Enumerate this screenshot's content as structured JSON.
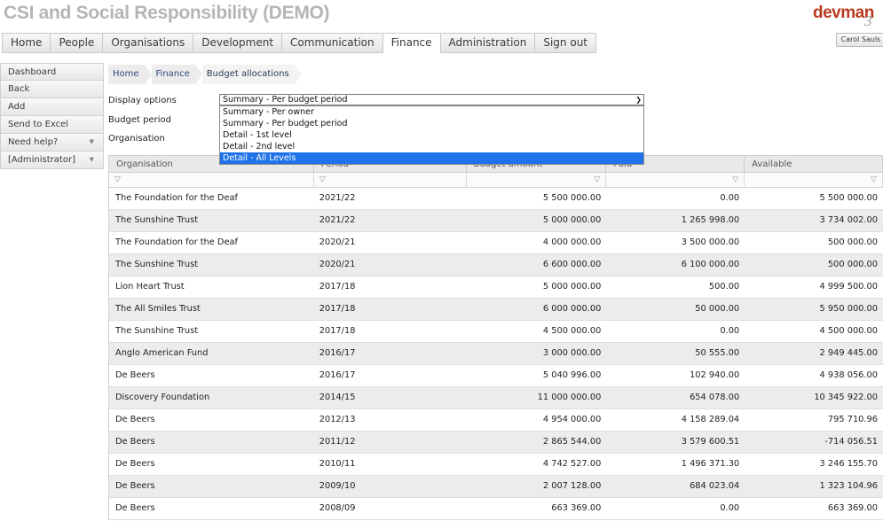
{
  "app": {
    "title": "CSI and Social Responsibility (DEMO)",
    "logo_text": "devman",
    "logo_digit": "3",
    "user_name": "Carol Sauls"
  },
  "topnav": [
    "Home",
    "People",
    "Organisations",
    "Development",
    "Communication",
    "Finance",
    "Administration",
    "Sign out"
  ],
  "topnav_active": "Finance",
  "sidebar": [
    {
      "label": "Dashboard",
      "has_caret": false
    },
    {
      "label": "Back",
      "has_caret": false
    },
    {
      "label": "Add",
      "has_caret": false
    },
    {
      "label": "Send to Excel",
      "has_caret": false
    },
    {
      "label": "Need help?",
      "has_caret": true
    },
    {
      "label": "[Administrator]",
      "has_caret": true
    }
  ],
  "breadcrumb": [
    "Home",
    "Finance",
    "Budget allocations"
  ],
  "options": {
    "display_label": "Display options",
    "budget_period_label": "Budget period",
    "organisation_label": "Organisation",
    "display_selected": "Summary - Per budget period",
    "dropdown_options": [
      "Summary - Per owner",
      "Summary - Per budget period",
      "Detail - 1st level",
      "Detail - 2nd level",
      "Detail - All Levels"
    ],
    "highlighted_option": "Detail - All Levels"
  },
  "grid": {
    "headers": [
      "Organisation",
      "Period",
      "Budget amount",
      "Paid",
      "Available"
    ],
    "rows": [
      [
        "The Foundation for the Deaf",
        "2021/22",
        "5 500 000.00",
        "0.00",
        "5 500 000.00"
      ],
      [
        "The Sunshine Trust",
        "2021/22",
        "5 000 000.00",
        "1 265 998.00",
        "3 734 002.00"
      ],
      [
        "The Foundation for the Deaf",
        "2020/21",
        "4 000 000.00",
        "3 500 000.00",
        "500 000.00"
      ],
      [
        "The Sunshine Trust",
        "2020/21",
        "6 600 000.00",
        "6 100 000.00",
        "500 000.00"
      ],
      [
        "Lion Heart Trust",
        "2017/18",
        "5 000 000.00",
        "500.00",
        "4 999 500.00"
      ],
      [
        "The All Smiles Trust",
        "2017/18",
        "6 000 000.00",
        "50 000.00",
        "5 950 000.00"
      ],
      [
        "The Sunshine Trust",
        "2017/18",
        "4 500 000.00",
        "0.00",
        "4 500 000.00"
      ],
      [
        "Anglo American Fund",
        "2016/17",
        "3 000 000.00",
        "50 555.00",
        "2 949 445.00"
      ],
      [
        "De Beers",
        "2016/17",
        "5 040 996.00",
        "102 940.00",
        "4 938 056.00"
      ],
      [
        "Discovery Foundation",
        "2014/15",
        "11 000 000.00",
        "654 078.00",
        "10 345 922.00"
      ],
      [
        "De Beers",
        "2012/13",
        "4 954 000.00",
        "4 158 289.04",
        "795 710.96"
      ],
      [
        "De Beers",
        "2011/12",
        "2 865 544.00",
        "3 579 600.51",
        "-714 056.51"
      ],
      [
        "De Beers",
        "2010/11",
        "4 742 527.00",
        "1 496 371.30",
        "3 246 155.70"
      ],
      [
        "De Beers",
        "2009/10",
        "2 007 128.00",
        "684 023.04",
        "1 323 104.96"
      ],
      [
        "De Beers",
        "2008/09",
        "663 369.00",
        "0.00",
        "663 369.00"
      ]
    ]
  },
  "colors": {
    "title": "#b5b5b5",
    "logo": "#b83a1e",
    "dropdown_highlight": "#1e73e8",
    "row_alt": "#ececec"
  },
  "icons": {
    "filter": "filter-icon",
    "dropdown": "chevron-down-icon",
    "sort": "sort-arrow-icon"
  }
}
